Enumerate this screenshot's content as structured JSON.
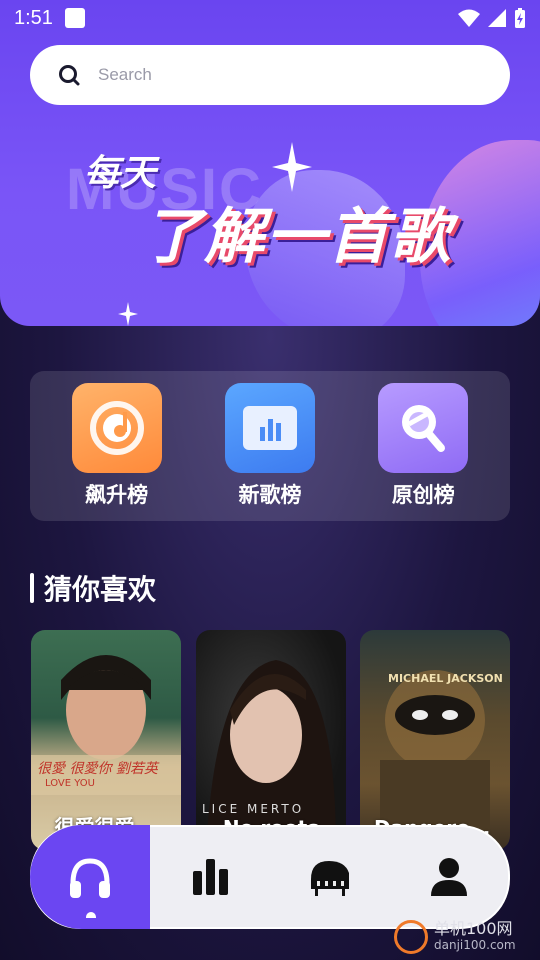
{
  "status_bar": {
    "time": "1:51"
  },
  "search": {
    "placeholder": "Search"
  },
  "banner": {
    "bg_text": "MUSIC",
    "small_text": "每天",
    "big_text": "了解一首歌"
  },
  "categories": [
    {
      "label": "飙升榜",
      "icon": "record-icon",
      "color": "#ff9a4a"
    },
    {
      "label": "新歌榜",
      "icon": "bar-chart-icon",
      "color": "#4b8df6"
    },
    {
      "label": "原创榜",
      "icon": "magnifier-icon",
      "color": "#9b7bf8"
    }
  ],
  "section": {
    "title": "猜你喜欢"
  },
  "songs": [
    {
      "title": "很爱很爱...",
      "art_text": "很愛 很愛你 劉若英",
      "art_subtext": "LOVE YOU"
    },
    {
      "title": "No roots",
      "art_text": "LICE MERTO"
    },
    {
      "title": "Dangerou...",
      "art_text": "MICHAEL JACKSON"
    }
  ],
  "nav": [
    {
      "icon": "headphones-icon",
      "active": true
    },
    {
      "icon": "bar-chart-icon",
      "active": false
    },
    {
      "icon": "piano-icon",
      "active": false
    },
    {
      "icon": "user-icon",
      "active": false
    }
  ],
  "watermark": {
    "text": "单机100网",
    "subtext": "danji100.com"
  },
  "colors": {
    "accent": "#6b46f2",
    "background": "#1d1640"
  }
}
